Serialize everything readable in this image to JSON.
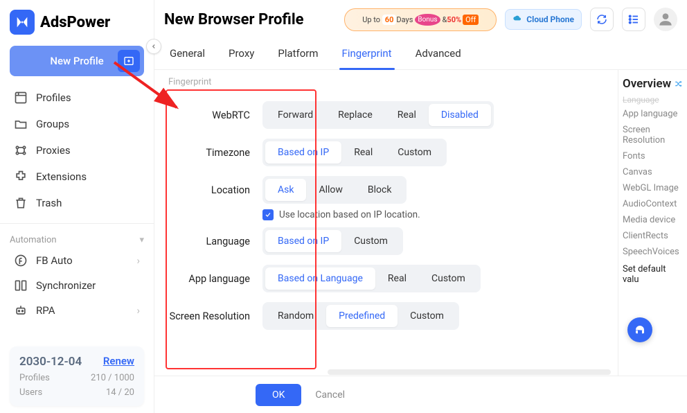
{
  "brand": "AdsPower",
  "sidebar": {
    "new_profile": "New Profile",
    "items": [
      {
        "icon": "profiles-icon",
        "label": "Profiles"
      },
      {
        "icon": "groups-icon",
        "label": "Groups"
      },
      {
        "icon": "proxies-icon",
        "label": "Proxies"
      },
      {
        "icon": "extensions-icon",
        "label": "Extensions"
      },
      {
        "icon": "trash-icon",
        "label": "Trash"
      }
    ],
    "automation_label": "Automation",
    "auto_items": [
      {
        "label": "FB Auto",
        "chev": true
      },
      {
        "label": "Synchronizer",
        "chev": false
      },
      {
        "label": "RPA",
        "chev": true
      }
    ],
    "stats": {
      "date": "2030-12-04",
      "renew": "Renew",
      "profiles_label": "Profiles",
      "profiles_val": "210 / 1000",
      "users_label": "Users",
      "users_val": "14 / 20"
    }
  },
  "header": {
    "title": "New Browser Profile",
    "promo_upto": "Up to",
    "promo_days": "60",
    "promo_days_lbl": "Days",
    "promo_bonus": "Bonus",
    "promo_amp": "&",
    "promo_pct": "50%",
    "promo_off": "Off",
    "cloud": "Cloud Phone"
  },
  "tabs": [
    "General",
    "Proxy",
    "Platform",
    "Fingerprint",
    "Advanced"
  ],
  "active_tab": "Fingerprint",
  "subheading": "Fingerprint",
  "settings": {
    "webrtc": {
      "label": "WebRTC",
      "opts": [
        "Forward",
        "Replace",
        "Real",
        "Disabled"
      ],
      "active": "Disabled"
    },
    "timezone": {
      "label": "Timezone",
      "opts": [
        "Based on IP",
        "Real",
        "Custom"
      ],
      "active": "Based on IP"
    },
    "location": {
      "label": "Location",
      "opts": [
        "Ask",
        "Allow",
        "Block"
      ],
      "active": "Ask"
    },
    "location_check": "Use location based on IP location.",
    "language": {
      "label": "Language",
      "opts": [
        "Based on IP",
        "Custom"
      ],
      "active": "Based on IP"
    },
    "app_language": {
      "label": "App language",
      "opts": [
        "Based on Language",
        "Real",
        "Custom"
      ],
      "active": "Based on Language"
    },
    "screen_res": {
      "label": "Screen Resolution",
      "opts": [
        "Random",
        "Predefined",
        "Custom"
      ],
      "active": "Predefined"
    }
  },
  "overview": {
    "title": "Overview",
    "struck": "Language",
    "items": [
      "App language",
      "Screen Resolution",
      "Fonts",
      "Canvas",
      "WebGL Image",
      "AudioContext",
      "Media device",
      "ClientRects",
      "SpeechVoices"
    ],
    "default": "Set default valu"
  },
  "footer": {
    "ok": "OK",
    "cancel": "Cancel"
  }
}
